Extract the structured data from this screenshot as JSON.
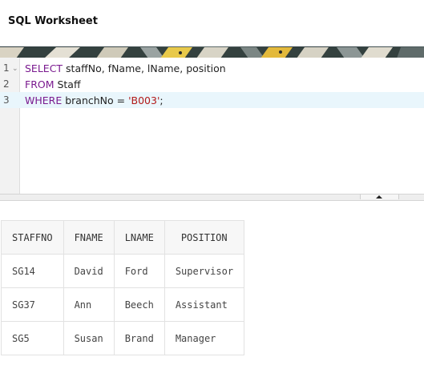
{
  "worksheet": {
    "title": "SQL Worksheet"
  },
  "editor": {
    "lines": [
      {
        "number": "1",
        "tokens": [
          {
            "type": "keyword",
            "text": "SELECT"
          },
          {
            "type": "text",
            "text": " staffNo, fName, lName, position"
          }
        ]
      },
      {
        "number": "2",
        "tokens": [
          {
            "type": "keyword",
            "text": "FROM"
          },
          {
            "type": "text",
            "text": " Staff"
          }
        ]
      },
      {
        "number": "3",
        "tokens": [
          {
            "type": "keyword",
            "text": "WHERE"
          },
          {
            "type": "text",
            "text": " branchNo = "
          },
          {
            "type": "string",
            "text": "'B003'"
          },
          {
            "type": "text",
            "text": ";"
          }
        ]
      }
    ],
    "active_line": 3,
    "fold_icon": "chevron-down-icon"
  },
  "results": {
    "columns": [
      "STAFFNO",
      "FNAME",
      "LNAME",
      "POSITION"
    ],
    "rows": [
      [
        "SG14",
        "David",
        "Ford",
        "Supervisor"
      ],
      [
        "SG37",
        "Ann",
        "Beech",
        "Assistant"
      ],
      [
        "SG5",
        "Susan",
        "Brand",
        "Manager"
      ]
    ]
  },
  "colors": {
    "keyword": "#7a1a8f",
    "string": "#b21a1a",
    "active_line_bg": "#e9f6fc"
  }
}
